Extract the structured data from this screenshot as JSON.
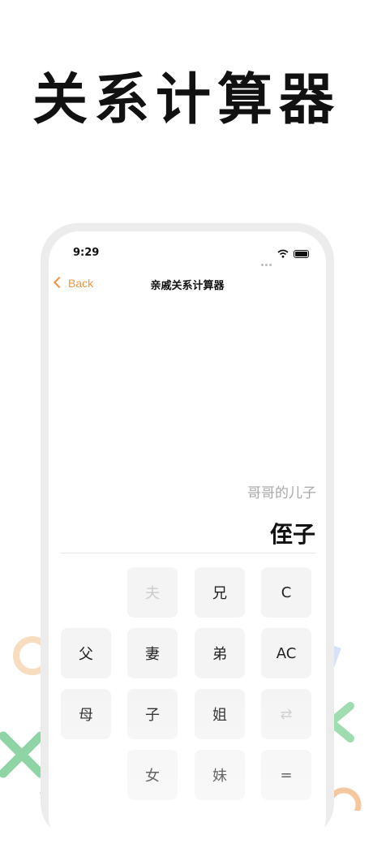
{
  "promo": {
    "title": "关系计算器"
  },
  "status_bar": {
    "time": "9:29"
  },
  "navbar": {
    "back_label": "Back",
    "title": "亲戚关系计算器"
  },
  "display": {
    "expression": "哥哥的儿子",
    "result": "侄子"
  },
  "keypad": {
    "row1": [
      "夫",
      "兄",
      "C"
    ],
    "row2": [
      "父",
      "妻",
      "弟",
      "AC"
    ],
    "row3": [
      "母",
      "子",
      "姐",
      "⇄"
    ],
    "row4": [
      "女",
      "妹",
      "="
    ]
  },
  "colors": {
    "accent": "#f0943b",
    "key_bg": "#f4f4f4",
    "hint_text": "#a8a8a8"
  }
}
